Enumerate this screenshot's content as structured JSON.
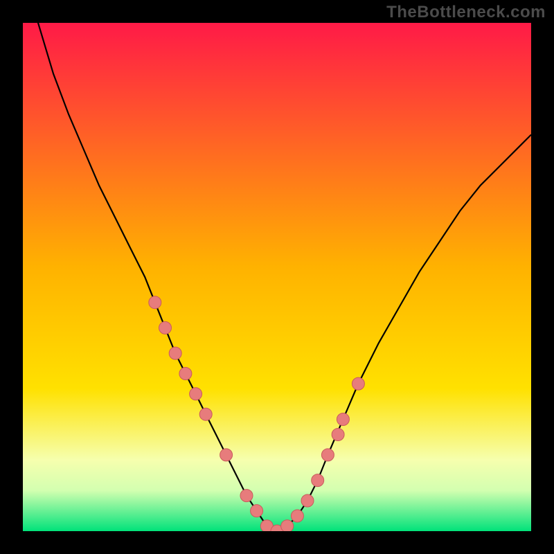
{
  "watermark": "TheBottleneck.com",
  "colors": {
    "bg": "#000000",
    "gradient_top": "#ff1a47",
    "gradient_mid": "#ffd400",
    "gradient_bottom1": "#f6ffae",
    "gradient_bottom2": "#d3ffb0",
    "gradient_bottom3": "#00e27a",
    "curve": "#000000",
    "marker_fill": "#e77c7c",
    "marker_stroke": "#c95b5b"
  },
  "chart_data": {
    "type": "line",
    "title": "",
    "xlabel": "",
    "ylabel": "",
    "xlim": [
      0,
      100
    ],
    "ylim": [
      0,
      100
    ],
    "series": [
      {
        "name": "bottleneck-curve",
        "x": [
          0,
          3,
          6,
          9,
          12,
          15,
          18,
          21,
          24,
          26,
          28,
          30,
          32,
          34,
          36,
          38,
          40,
          42,
          44,
          46,
          48,
          50,
          52,
          54,
          56,
          58,
          60,
          63,
          66,
          70,
          74,
          78,
          82,
          86,
          90,
          94,
          98,
          100
        ],
        "y": [
          120,
          100,
          90,
          82,
          75,
          68,
          62,
          56,
          50,
          45,
          40,
          35,
          31,
          27,
          23,
          19,
          15,
          11,
          7,
          4,
          1,
          0,
          1,
          3,
          6,
          10,
          15,
          22,
          29,
          37,
          44,
          51,
          57,
          63,
          68,
          72,
          76,
          78
        ]
      }
    ],
    "markers": {
      "name": "highlighted-points",
      "x": [
        26,
        28,
        30,
        32,
        34,
        36,
        40,
        44,
        46,
        48,
        50,
        52,
        54,
        56,
        58,
        60,
        62,
        63,
        66
      ],
      "y": [
        45,
        40,
        35,
        31,
        27,
        23,
        15,
        7,
        4,
        1,
        0,
        1,
        3,
        6,
        10,
        15,
        19,
        22,
        29
      ]
    }
  }
}
